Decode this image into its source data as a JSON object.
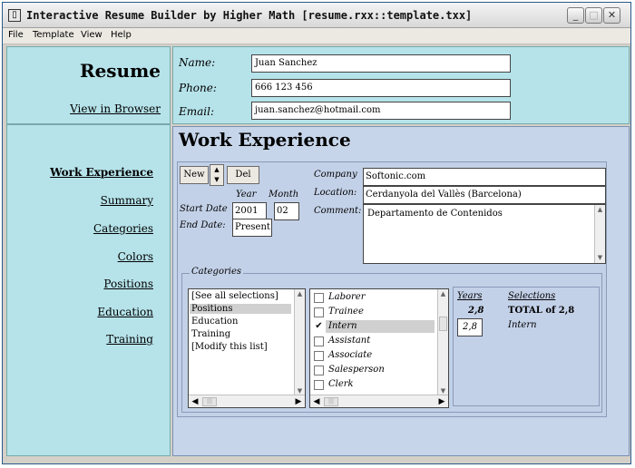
{
  "window": {
    "title": "Interactive Resume Builder by Higher Math [resume.rxx::template.txx]",
    "icon": "app-icon",
    "min_label": "_",
    "max_label": "□",
    "close_label": "✕"
  },
  "menu": [
    "File",
    "Template",
    "View",
    "Help"
  ],
  "sidebar": {
    "heading": "Resume",
    "view_link": "View in Browser",
    "nav": [
      "Work Experience",
      "Summary",
      "Categories",
      "Colors",
      "Positions",
      "Education",
      "Training"
    ],
    "active": "Work Experience"
  },
  "contact": {
    "name_label": "Name:",
    "name_value": "Juan Sanchez",
    "phone_label": "Phone:",
    "phone_value": "666 123 456",
    "email_label": "Email:",
    "email_value": "juan.sanchez@hotmail.com"
  },
  "work": {
    "section_title": "Work Experience",
    "new_label": "New",
    "del_label": "Del",
    "year_header": "Year",
    "month_header": "Month",
    "start_label": "Start Date",
    "start_year": "2001",
    "start_month": "02",
    "end_label": "End Date:",
    "end_value": "Present",
    "company_label": "Company",
    "company_value": "Softonic.com",
    "location_label": "Location:",
    "location_value": "Cerdanyola del Vallès (Barcelona)",
    "comment_label": "Comment:",
    "comment_value": "Departamento de Contenidos"
  },
  "categories": {
    "legend": "Categories",
    "list": [
      "[See all selections]",
      "Positions",
      "Education",
      "Training",
      "[Modify this list]"
    ],
    "list_selected": "Positions",
    "options": [
      {
        "label": "Laborer",
        "checked": false
      },
      {
        "label": "Trainee",
        "checked": false
      },
      {
        "label": "Intern",
        "checked": true
      },
      {
        "label": "Assistant",
        "checked": false
      },
      {
        "label": "Associate",
        "checked": false
      },
      {
        "label": "Salesperson",
        "checked": false
      },
      {
        "label": "Clerk",
        "checked": false
      }
    ],
    "years_header": "Years",
    "selections_header": "Selections",
    "total_years": "2,8",
    "total_label": "TOTAL of 2,8",
    "row_years": "2,8",
    "row_selection": "Intern"
  }
}
